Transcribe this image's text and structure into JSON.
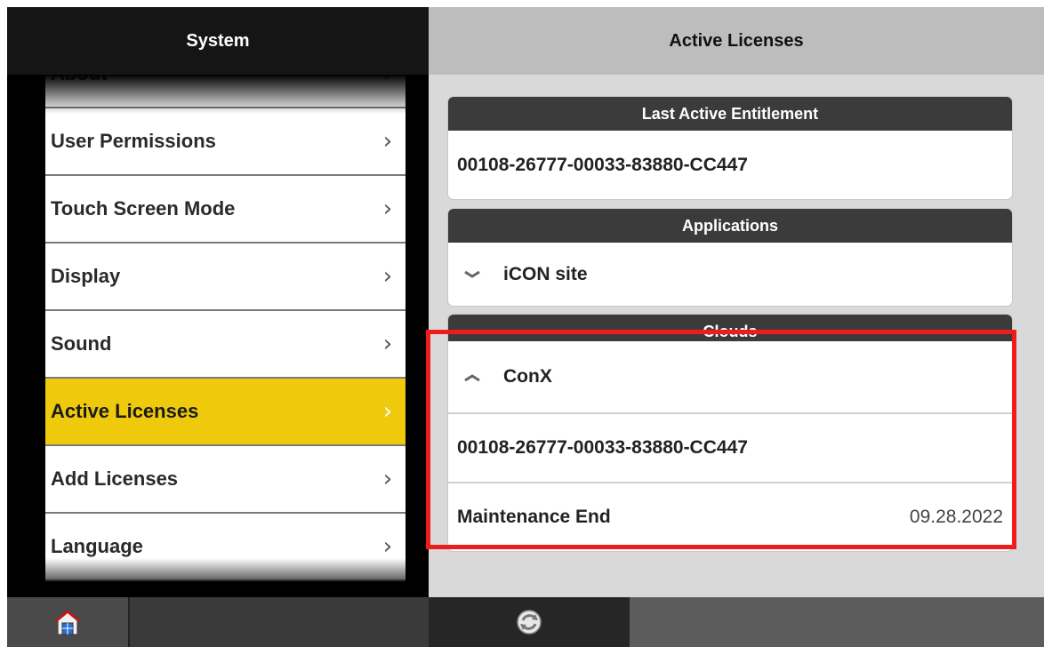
{
  "left": {
    "title": "System",
    "menu": [
      {
        "label": "About",
        "chevron": "›"
      },
      {
        "label": "User Permissions",
        "chevron": "›"
      },
      {
        "label": "Touch Screen Mode",
        "chevron": "›"
      },
      {
        "label": "Display",
        "chevron": "›"
      },
      {
        "label": "Sound",
        "chevron": "›"
      },
      {
        "label": "Active Licenses",
        "chevron": "›"
      },
      {
        "label": "Add Licenses",
        "chevron": "›"
      },
      {
        "label": "Language",
        "chevron": "›"
      }
    ],
    "active_item": "Active Licenses",
    "footer": {
      "home_icon": "home-icon"
    }
  },
  "right": {
    "title": "Active Licenses",
    "entitlement": {
      "header": "Last Active Entitlement",
      "value": "00108-26777-00033-83880-CC447"
    },
    "applications": {
      "header": "Applications",
      "item": "iCON site",
      "expand_icon": "chevron-down-icon"
    },
    "clouds": {
      "header": "Clouds",
      "item": "ConX",
      "expand_icon": "chevron-up-icon",
      "license": "00108-26777-00033-83880-CC447",
      "maintenance_label": "Maintenance End",
      "maintenance_value": "09.28.2022"
    },
    "footer": {
      "refresh_icon": "refresh-icon"
    }
  },
  "colors": {
    "accent": "#efca0c",
    "highlight": "#ee1c1c",
    "card_header": "#3b3b3b"
  }
}
